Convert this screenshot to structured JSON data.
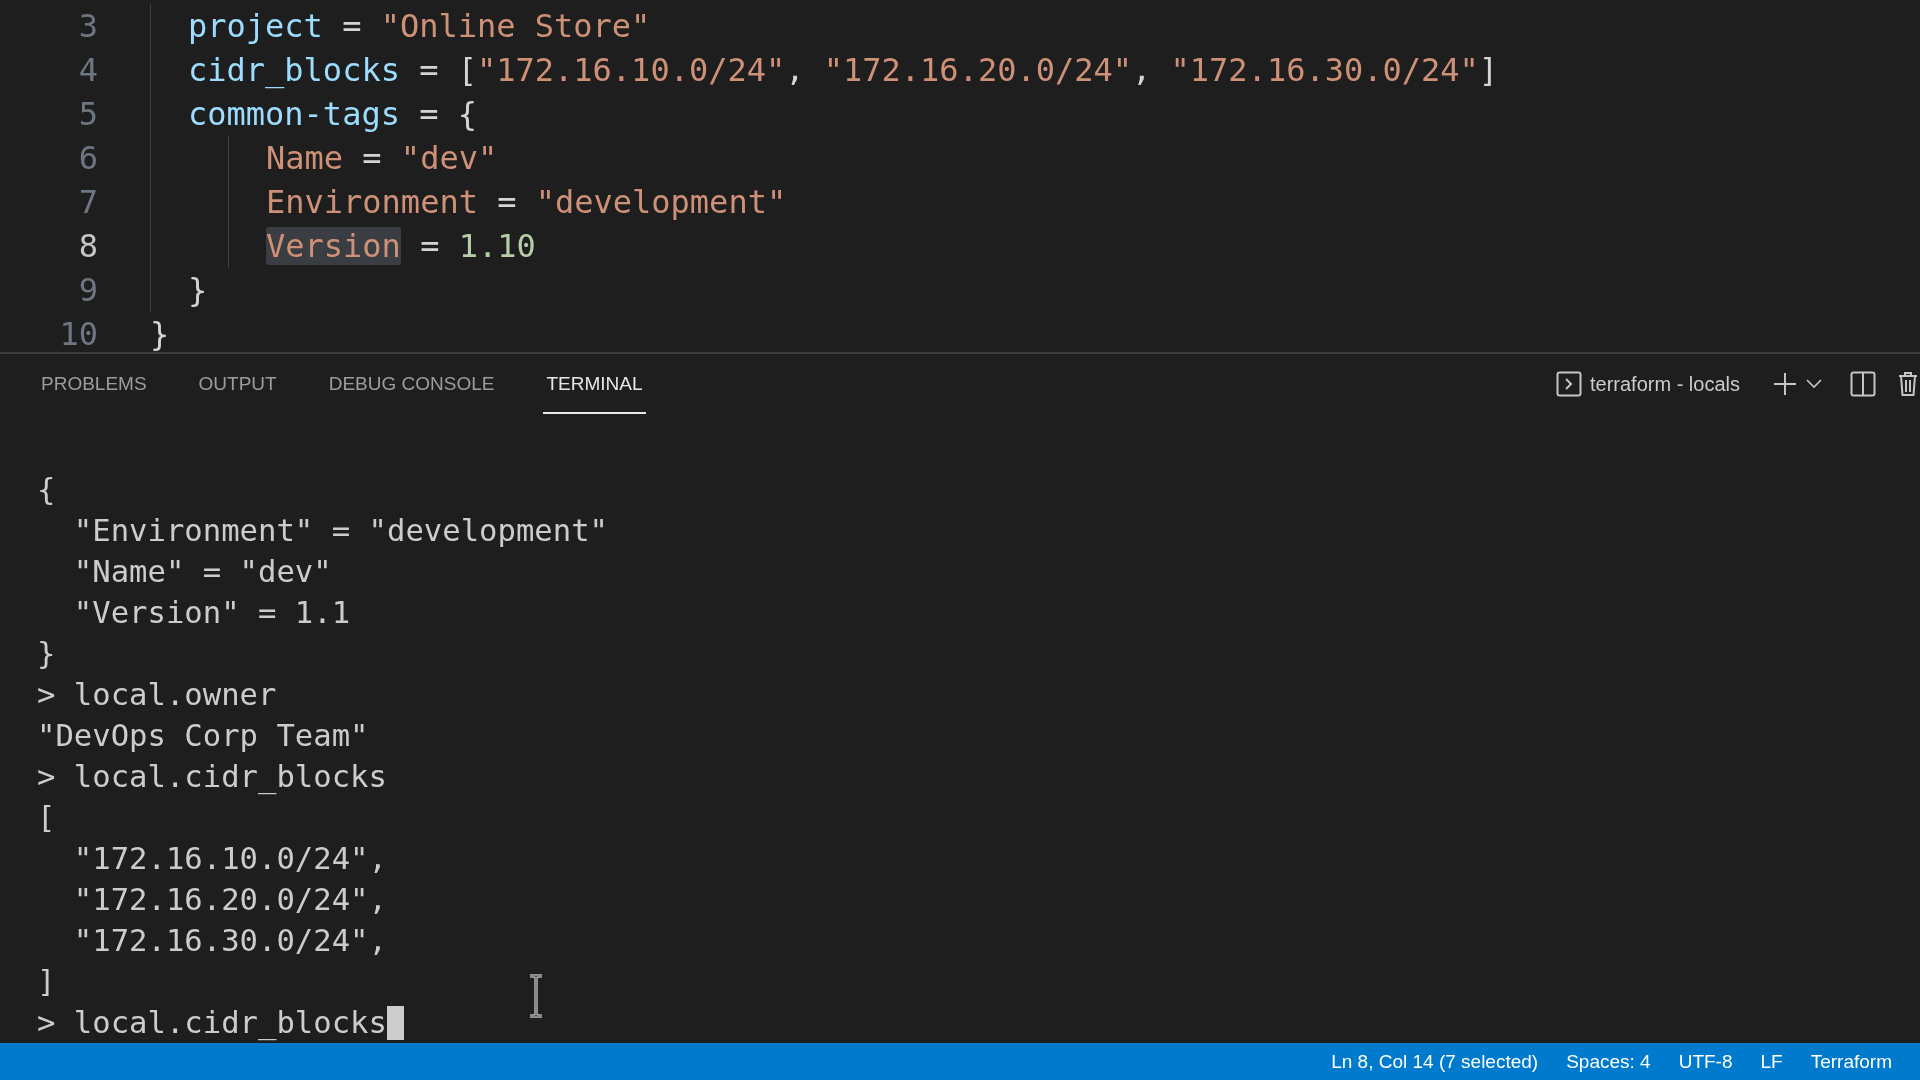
{
  "editor": {
    "lines": [
      {
        "children": [
          {
            "number": "3",
            "active": false,
            "tokens": [
              {
                "kind": "key",
                "text": "project"
              },
              {
                "kind": "punct",
                "text": " = "
              },
              {
                "kind": "string",
                "text": "\"Online Store\""
              }
            ]
          },
          {
            "number": "4",
            "active": false,
            "tokens": [
              {
                "kind": "key",
                "text": "cidr_blocks"
              },
              {
                "kind": "punct",
                "text": " = ["
              },
              {
                "kind": "string",
                "text": "\"172.16.10.0/24\""
              },
              {
                "kind": "punct",
                "text": ", "
              },
              {
                "kind": "string",
                "text": "\"172.16.20.0/24\""
              },
              {
                "kind": "punct",
                "text": ", "
              },
              {
                "kind": "string",
                "text": "\"172.16.30.0/24\""
              },
              {
                "kind": "punct",
                "text": "]"
              }
            ]
          },
          {
            "number": "5",
            "active": false,
            "tokens": [
              {
                "kind": "key",
                "text": "common-tags"
              },
              {
                "kind": "punct",
                "text": " = {"
              }
            ],
            "children": [
              {
                "number": "6",
                "active": false,
                "tokens": [
                  {
                    "kind": "attr",
                    "text": "Name"
                  },
                  {
                    "kind": "punct",
                    "text": " = "
                  },
                  {
                    "kind": "string",
                    "text": "\"dev\""
                  }
                ]
              },
              {
                "number": "7",
                "active": false,
                "tokens": [
                  {
                    "kind": "attr",
                    "text": "Environment"
                  },
                  {
                    "kind": "punct",
                    "text": " = "
                  },
                  {
                    "kind": "string",
                    "text": "\"development\""
                  }
                ]
              },
              {
                "number": "8",
                "active": true,
                "tokens": [
                  {
                    "kind": "attr",
                    "text": "Version",
                    "highlighted": true
                  },
                  {
                    "kind": "punct",
                    "text": " = "
                  },
                  {
                    "kind": "number",
                    "text": "1.10"
                  }
                ]
              }
            ]
          },
          {
            "number": "9",
            "active": false,
            "tokens": [
              {
                "kind": "punct",
                "text": "}"
              }
            ]
          }
        ]
      },
      {
        "number": "10",
        "active": false,
        "tokens": [
          {
            "kind": "punct",
            "text": "}"
          }
        ]
      }
    ]
  },
  "panel": {
    "tabs": [
      {
        "label": "PROBLEMS",
        "selected": false
      },
      {
        "label": "OUTPUT",
        "selected": false
      },
      {
        "label": "DEBUG CONSOLE",
        "selected": false
      },
      {
        "label": "TERMINAL",
        "selected": true
      }
    ],
    "terminal_name": "terraform - locals",
    "terminal_lines": [
      "{",
      "  \"Environment\" = \"development\"",
      "  \"Name\" = \"dev\"",
      "  \"Version\" = 1.1",
      "}",
      "> local.owner",
      "\"DevOps Corp Team\"",
      "> local.cidr_blocks",
      "[",
      "  \"172.16.10.0/24\",",
      "  \"172.16.20.0/24\",",
      "  \"172.16.30.0/24\",",
      "]"
    ],
    "input": "> local.cidr_blocks"
  },
  "status_bar": {
    "items": [
      "Ln 8, Col 14 (7 selected)",
      "Spaces: 4",
      "UTF-8",
      "LF",
      "Terraform"
    ]
  }
}
